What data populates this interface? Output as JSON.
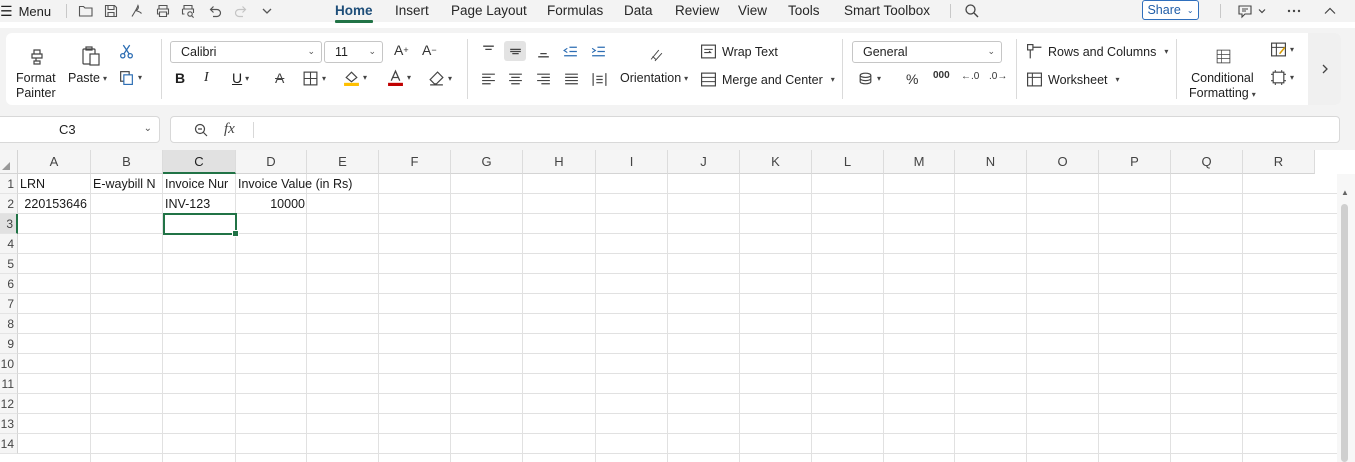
{
  "app": {
    "menu_label": "Menu",
    "tabs": [
      {
        "label": "Home",
        "active": true
      },
      {
        "label": "Insert"
      },
      {
        "label": "Page Layout"
      },
      {
        "label": "Formulas"
      },
      {
        "label": "Data"
      },
      {
        "label": "Review"
      },
      {
        "label": "View"
      },
      {
        "label": "Tools"
      },
      {
        "label": "Smart Toolbox"
      }
    ],
    "share_label": "Share",
    "accent_color": "#217346",
    "link_color": "#1e4e79"
  },
  "ribbon": {
    "format_painter_line1": "Format",
    "format_painter_line2": "Painter",
    "paste_label": "Paste",
    "font_name": "Calibri",
    "font_size": "11",
    "wrap_text_label": "Wrap Text",
    "orientation_label": "Orientation",
    "merge_center_label": "Merge and Center",
    "number_format": "General",
    "percent_symbol": "%",
    "thousands_symbol": "000",
    "rows_columns_label": "Rows and Columns",
    "worksheet_label": "Worksheet",
    "conditional_line1": "Conditional",
    "conditional_line2": "Formatting",
    "font_color": "#c00000",
    "fill_color": "#ffc000"
  },
  "formula_bar": {
    "name_box": "C3",
    "fx_label": "fx",
    "formula": ""
  },
  "sheet": {
    "columns": [
      "A",
      "B",
      "C",
      "D",
      "E",
      "F",
      "G",
      "H",
      "I",
      "J",
      "K",
      "L",
      "M",
      "N",
      "O",
      "P",
      "Q",
      "R"
    ],
    "selected_column": "C",
    "rows": [
      "1",
      "2",
      "3",
      "4",
      "5",
      "6",
      "7",
      "8",
      "9",
      "10",
      "11",
      "12",
      "13",
      "14"
    ],
    "selected_row": "3",
    "cells": {
      "A1": "LRN",
      "B1": "E-waybill N",
      "C1": "Invoice Nur",
      "D1": "Invoice Value (in Rs)",
      "A2": "220153646",
      "B2": "",
      "C2": "INV-123",
      "D2": "10000"
    }
  }
}
